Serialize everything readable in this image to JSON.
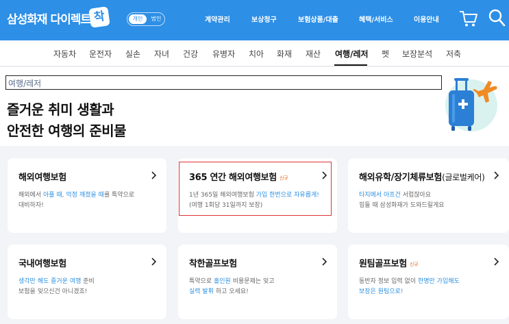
{
  "header": {
    "logo_text": "삼성화재 다이렉트",
    "logo_badge": "착",
    "toggle_on": "개인",
    "toggle_off": "법인",
    "nav": [
      "계약관리",
      "보상청구",
      "보험상품/대출",
      "혜택/서비스",
      "이용안내"
    ],
    "cart_icon": "cart-icon",
    "search_icon": "search-icon",
    "brand_color": "#2d8fe6"
  },
  "categories": [
    "자동차",
    "운전자",
    "실손",
    "자녀",
    "건강",
    "유병자",
    "치아",
    "화재",
    "재산",
    "여행/레저",
    "펫",
    "보장분석",
    "저축"
  ],
  "active_category": "여행/레저",
  "hero": {
    "breadcrumb": "여행/레저",
    "title_line1": "즐거운 취미 생활과",
    "title_line2": "안전한 여행의 준비물",
    "illustration": "luggage-airplane-illustration"
  },
  "cards": [
    {
      "title": "해외여행보험",
      "title_suffix": "",
      "tag": "",
      "line1": [
        "해외에서 ",
        "아플 때, 억정 깨졌을 때",
        "를 특약으로"
      ],
      "line2": [
        "대비하자!",
        "",
        ""
      ]
    },
    {
      "title": "365 연간 해외여행보험",
      "title_suffix": "",
      "tag": "신규",
      "line1": [
        "1년 365일 해외여행보험 ",
        "가입 한번으로 자유롭게!",
        ""
      ],
      "line2": [
        "(여행 1회당 31일까지 보장)",
        "",
        ""
      ]
    },
    {
      "title": "해외유학/장기체류보험",
      "title_suffix": "(글로벌케어)",
      "tag": "",
      "line1": [
        "",
        "타지에서 아프건",
        " 서럽잖아요"
      ],
      "line2": [
        "힘들 때 삼성화재가 도와드릴게요",
        "",
        ""
      ]
    },
    {
      "title": "국내여행보험",
      "title_suffix": "",
      "tag": "",
      "line1": [
        "",
        "생각만 해도 즐거운 여행",
        " 준비"
      ],
      "line2": [
        "보험을 잊으신건 아니겠죠!",
        "",
        ""
      ]
    },
    {
      "title": "착한골프보험",
      "title_suffix": "",
      "tag": "",
      "line1": [
        "특약으로 ",
        "홀인원",
        " 비용문제는 잊고"
      ],
      "line2": [
        "",
        "실력 발휘",
        " 하고 오세요!"
      ]
    },
    {
      "title": "원팀골프보험",
      "title_suffix": "",
      "tag": "신규",
      "line1": [
        "동반자 정보 입력 없이 ",
        "한명만 가입해도",
        ""
      ],
      "line2": [
        "",
        "보장은 원팀으로!",
        ""
      ]
    }
  ],
  "colors": {
    "highlight_text": "#2b8fe0",
    "new_tag": "#e8681b",
    "selection_border": "#d33"
  }
}
